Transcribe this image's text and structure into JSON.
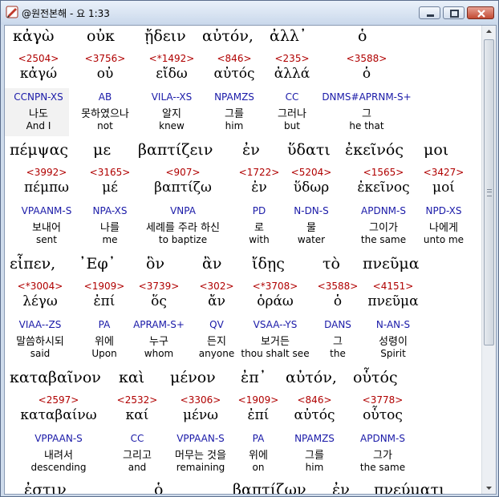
{
  "window": {
    "title": "@원전본해 - 요 1:33"
  },
  "verse_rows": [
    {
      "words": [
        {
          "greek": "κἀγὼ",
          "strong": "<2504>",
          "lemma": "κἀγώ",
          "parse": "CCNPN-XS",
          "korean": "나도",
          "english": "And I"
        },
        {
          "greek": "οὐκ",
          "strong": "<3756>",
          "lemma": "οὐ",
          "parse": "AB",
          "korean": "못하였으나",
          "english": "not"
        },
        {
          "greek": "ᾔδειν",
          "strong": "<*1492>",
          "lemma": "εἴδω",
          "parse": "VILA--XS",
          "korean": "알지",
          "english": "knew"
        },
        {
          "greek": "αὐτόν,",
          "strong": "<846>",
          "lemma": "αὐτός",
          "parse": "NPAMZS",
          "korean": "그를",
          "english": "him"
        },
        {
          "greek": "ἀλλ᾽",
          "strong": "<235>",
          "lemma": "ἀλλά",
          "parse": "CC",
          "korean": "그러나",
          "english": "but"
        },
        {
          "greek": "ὁ",
          "strong": "<3588>",
          "lemma": "ὁ",
          "parse": "DNMS#APRNM-S+",
          "korean": "그",
          "english": "he that"
        }
      ]
    },
    {
      "words": [
        {
          "greek": "πέμψας",
          "strong": "<3992>",
          "lemma": "πέμπω",
          "parse": "VPAANM-S",
          "korean": "보내어",
          "english": "sent"
        },
        {
          "greek": "με",
          "strong": "<3165>",
          "lemma": "μέ",
          "parse": "NPA-XS",
          "korean": "나를",
          "english": "me"
        },
        {
          "greek": "βαπτίζειν",
          "strong": "<907>",
          "lemma": "βαπτίζω",
          "parse": "VNPA",
          "korean": "세례를 주라 하신",
          "english": "to baptize"
        },
        {
          "greek": "ἐν",
          "strong": "<1722>",
          "lemma": "ἐν",
          "parse": "PD",
          "korean": "로",
          "english": "with"
        },
        {
          "greek": "ὕδατι",
          "strong": "<5204>",
          "lemma": "ὕδωρ",
          "parse": "N-DN-S",
          "korean": "물",
          "english": "water"
        },
        {
          "greek": "ἐκεῖνός",
          "strong": "<1565>",
          "lemma": "ἐκεῖνος",
          "parse": "APDNM-S",
          "korean": "그이가",
          "english": "the same"
        },
        {
          "greek": "μοι",
          "strong": "<3427>",
          "lemma": "μοί",
          "parse": "NPD-XS",
          "korean": "나에게",
          "english": "unto me"
        }
      ]
    },
    {
      "words": [
        {
          "greek": "εἶπεν,",
          "strong": "<*3004>",
          "lemma": "λέγω",
          "parse": "VIAA--ZS",
          "korean": "말씀하시되",
          "english": "said"
        },
        {
          "greek": "᾿Εφ᾽",
          "strong": "<1909>",
          "lemma": "ἐπί",
          "parse": "PA",
          "korean": "위에",
          "english": "Upon"
        },
        {
          "greek": "ὃν",
          "strong": "<3739>",
          "lemma": "ὅς",
          "parse": "APRAM-S+",
          "korean": "누구",
          "english": "whom"
        },
        {
          "greek": "ἂν",
          "strong": "<302>",
          "lemma": "ἄν",
          "parse": "QV",
          "korean": "든지",
          "english": "anyone"
        },
        {
          "greek": "ἴδῃς",
          "strong": "<*3708>",
          "lemma": "ὁράω",
          "parse": "VSAA--YS",
          "korean": "보거든",
          "english": "thou shalt see"
        },
        {
          "greek": "τὸ",
          "strong": "<3588>",
          "lemma": "ὁ",
          "parse": "DANS",
          "korean": "그",
          "english": "the"
        },
        {
          "greek": "πνεῦμα",
          "strong": "<4151>",
          "lemma": "πνεῦμα",
          "parse": "N-AN-S",
          "korean": "성령이",
          "english": "Spirit"
        }
      ]
    },
    {
      "words": [
        {
          "greek": "καταβαῖνον",
          "strong": "<2597>",
          "lemma": "καταβαίνω",
          "parse": "VPPAAN-S",
          "korean": "내려서",
          "english": "descending"
        },
        {
          "greek": "καὶ",
          "strong": "<2532>",
          "lemma": "καί",
          "parse": "CC",
          "korean": "그리고",
          "english": "and"
        },
        {
          "greek": "μένον",
          "strong": "<3306>",
          "lemma": "μένω",
          "parse": "VPPAAN-S",
          "korean": "머무는 것을",
          "english": "remaining"
        },
        {
          "greek": "ἐπ᾽",
          "strong": "<1909>",
          "lemma": "ἐπί",
          "parse": "PA",
          "korean": "위에",
          "english": "on"
        },
        {
          "greek": "αὐτόν,",
          "strong": "<846>",
          "lemma": "αὐτός",
          "parse": "NPAMZS",
          "korean": "그를",
          "english": "him"
        },
        {
          "greek": "οὗτός",
          "strong": "<3778>",
          "lemma": "οὗτος",
          "parse": "APDNM-S",
          "korean": "그가",
          "english": "the same"
        }
      ]
    }
  ],
  "partial_row": {
    "greek_words": [
      "ἐστιν",
      "ὁ",
      "βαπτίζων",
      "ἐν",
      "πνεύματι"
    ]
  }
}
